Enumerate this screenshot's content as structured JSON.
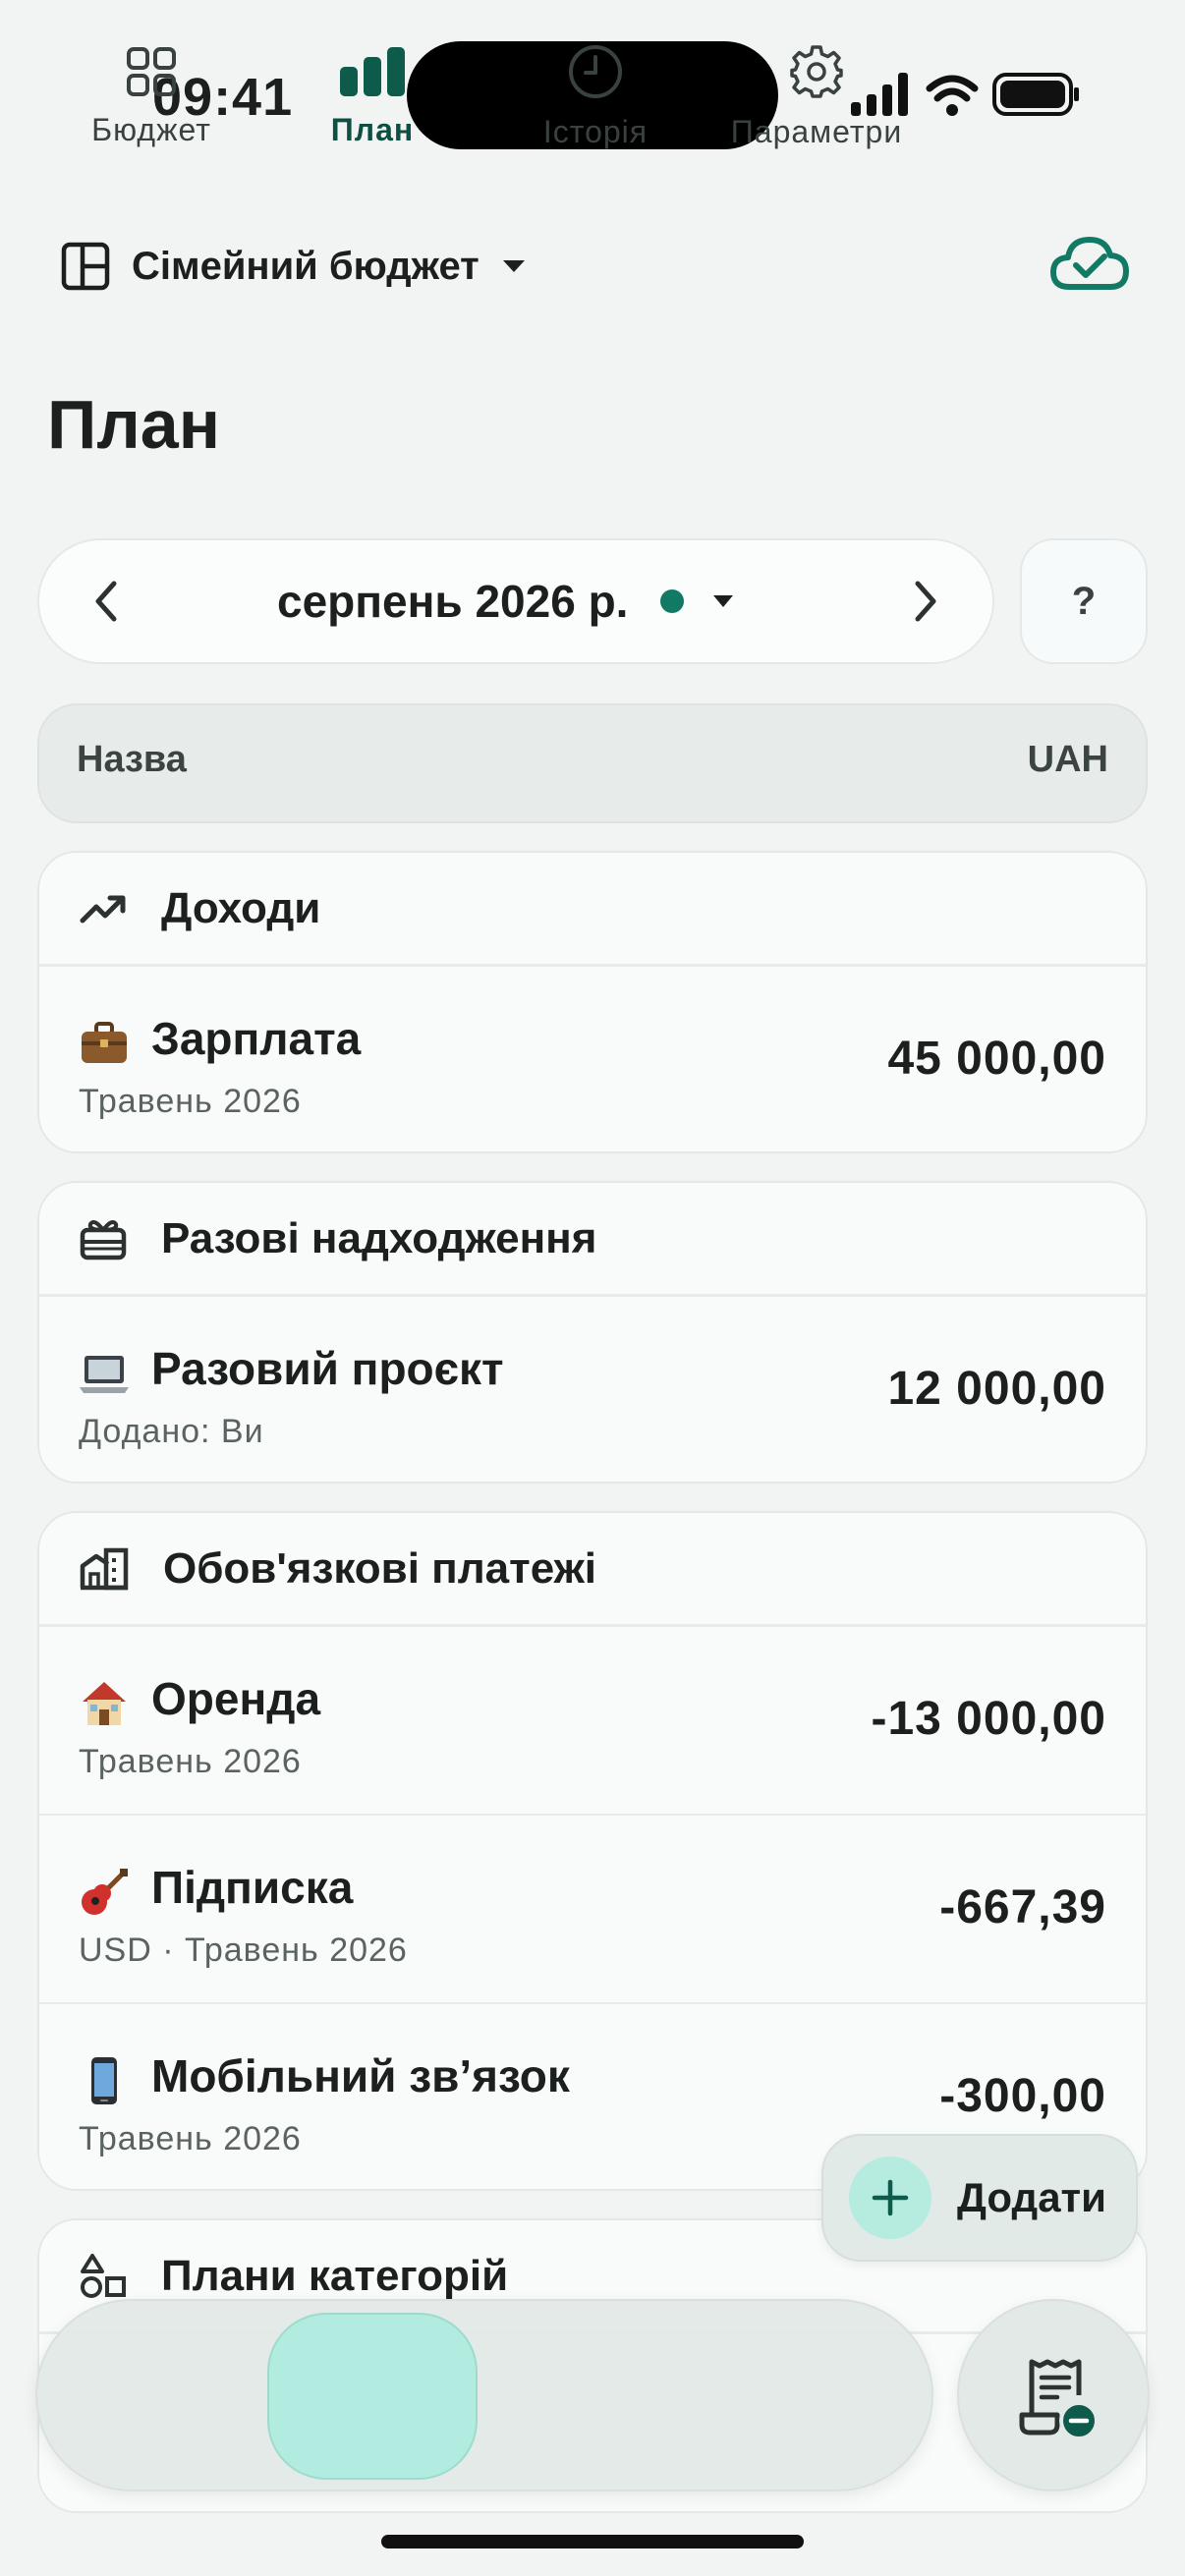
{
  "status": {
    "time": "09:41"
  },
  "header": {
    "budget_name": "Сімейний бюджет",
    "page_title": "План"
  },
  "period": {
    "label": "серпень 2026 р.",
    "help": "?"
  },
  "columns": {
    "name": "Назва",
    "currency": "UAH"
  },
  "sections": [
    {
      "title": "Доходи",
      "icon": "trending-up-icon",
      "rows": [
        {
          "emoji": "💼",
          "title": "Зарплата",
          "subtitle": "Травень 2026",
          "amount": "45 000,00"
        }
      ]
    },
    {
      "title": "Разові надходження",
      "icon": "gift-icon",
      "rows": [
        {
          "emoji": "💻",
          "title": "Разовий проєкт",
          "subtitle": "Додано: Ви",
          "amount": "12 000,00"
        }
      ]
    },
    {
      "title": "Обов'язкові платежі",
      "icon": "building-icon",
      "rows": [
        {
          "emoji": "🏠",
          "title": "Оренда",
          "subtitle": "Травень 2026",
          "amount": "-13 000,00"
        },
        {
          "emoji": "🎸",
          "title": "Підписка",
          "subtitle": "USD · Травень 2026",
          "amount": "-667,39"
        },
        {
          "emoji": "📱",
          "title": "Мобільний зв’язок",
          "subtitle": "Травень 2026",
          "amount": "-300,00"
        }
      ]
    },
    {
      "title": "Плани категорій",
      "icon": "shapes-icon",
      "rows": []
    }
  ],
  "fab": {
    "label": "Додати"
  },
  "nav": {
    "items": [
      {
        "label": "Бюджет",
        "icon": "grid-icon"
      },
      {
        "label": "План",
        "icon": "bar-chart-icon"
      },
      {
        "label": "Історія",
        "icon": "clock-icon"
      },
      {
        "label": "Параметри",
        "icon": "gear-icon"
      }
    ],
    "active_index": 1
  },
  "colors": {
    "accent": "#127a64",
    "accent_light": "#b2ebdf",
    "background": "#f1f4f3"
  }
}
